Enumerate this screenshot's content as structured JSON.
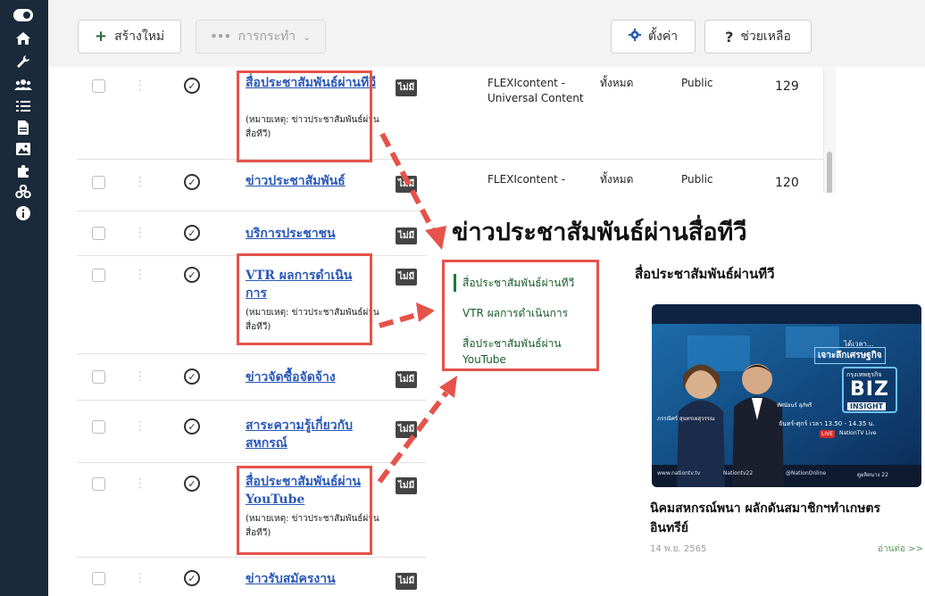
{
  "toolbar": {
    "new_label": "สร้างใหม่",
    "actions_label": "การกระทำ",
    "settings_label": "ตั้งค่า",
    "help_label": "ช่วยเหลือ"
  },
  "sidebar_icons": [
    "toggle-icon",
    "home-icon",
    "wrench-icon",
    "users-icon",
    "list-icon",
    "file-icon",
    "image-icon",
    "puzzle-icon",
    "components-icon",
    "info-icon"
  ],
  "rows": [
    {
      "title": "สื่อประชาสัมพันธ์ผ่านทีวี",
      "note": "(หมายเหตุ: ข่าวประชาสัมพันธ์ผ่านสื่อทีวี)",
      "lang": "ไม่มี",
      "type": "FLEXIcontent - Universal Content",
      "access_all": "ทั้งหมด",
      "access": "Public",
      "hits": "129"
    },
    {
      "title": "ข่าวประชาสัมพันธ์",
      "note": "",
      "lang": "ไม่มี",
      "type": "FLEXIcontent -",
      "access_all": "ทั้งหมด",
      "access": "Public",
      "hits": "120"
    },
    {
      "title": "บริการประชาชน",
      "note": "",
      "lang": "ไม่มี"
    },
    {
      "title": "VTR ผลการดำเนินการ",
      "note": "(หมายเหตุ: ข่าวประชาสัมพันธ์ผ่านสื่อทีวี)",
      "lang": "ไม่มี"
    },
    {
      "title": "ข่าวจัดซื้อจัดจ้าง",
      "note": "",
      "lang": "ไม่มี"
    },
    {
      "title": "สาระความรู้เกี่ยวกับสหกรณ์",
      "note": "",
      "lang": "ไม่มี"
    },
    {
      "title": "สื่อประชาสัมพันธ์ผ่าน YouTube",
      "note": "(หมายเหตุ: ข่าวประชาสัมพันธ์ผ่านสื่อทีวี)",
      "lang": "ไม่มี"
    },
    {
      "title": "ข่าวรับสมัครงาน",
      "note": "",
      "lang": "ไม่มี"
    }
  ],
  "overlay": {
    "heading": "ข่าวประชาสัมพันธ์ผ่านสื่อทีวี",
    "menu": [
      "สื่อประชาสัมพันธ์ผ่านทีวี",
      "VTR ผลการดำเนินการ",
      "สื่อประชาสัมพันธ์ผ่าน YouTube"
    ],
    "news_section_title": "สื่อประชาสัมพันธ์ผ่านทีวี",
    "thumbnail": {
      "line1": "ได้เวลา...",
      "line2": "เจาะลึกเศรษฐกิจ",
      "brand_top": "กรุงเทพธุรกิจ",
      "brand_biz": "BIZ",
      "brand_insight": "INSIGHT",
      "schedule": "จันทร์-ศุกร์ เวลา 13.50 - 14.35 น.",
      "live": "LIVE",
      "live_channel": "NationTV Live",
      "host1": "ภรรณิศร์ สุนทรเยสุวรรณ",
      "host2": "ทัศนัยนร์ สุภัทรี",
      "footer_site": "www.nationtv.tv",
      "footer_social": "Nationtv22",
      "footer_online": "@NationOnline",
      "footer_channel": "ดูผลิตนาง 22"
    },
    "card_title": "นิคมสหกรณ์พนา ผลักดันสมาชิกฯทำเกษตรอินทรีย์",
    "card_date": "14 พ.ย. 2565",
    "read_more": "อ่านต่อ >>"
  },
  "colors": {
    "sidebar": "#1a2a3a",
    "link": "#2a59b8",
    "annotation_red": "#e5534b",
    "menu_green": "#1a5c2a"
  }
}
